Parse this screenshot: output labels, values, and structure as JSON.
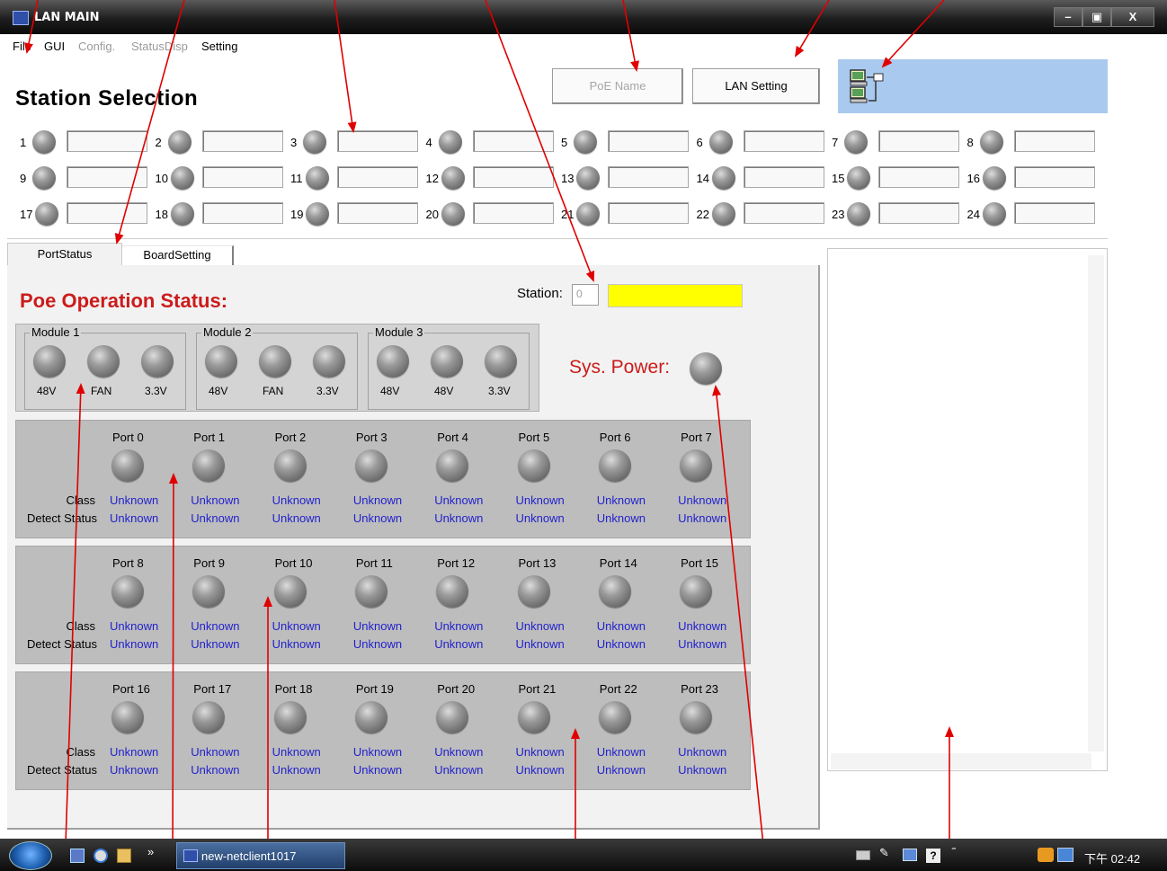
{
  "window": {
    "title": "LAN MAIN",
    "buttons": [
      "–",
      "▣",
      "X"
    ]
  },
  "menu": {
    "items": [
      {
        "label": "File",
        "enabled": true
      },
      {
        "label": "GUI",
        "enabled": true
      },
      {
        "label": "Config.",
        "enabled": false
      },
      {
        "label": "StatusDisp",
        "enabled": false
      },
      {
        "label": "Setting",
        "enabled": true
      }
    ]
  },
  "header": {
    "title": "Station Selection",
    "poe_name_button": "PoE Name",
    "lan_setting_button": "LAN Setting",
    "network_icon": "network-computers-icon"
  },
  "stations": [
    "1",
    "2",
    "3",
    "4",
    "5",
    "6",
    "7",
    "8",
    "9",
    "10",
    "11",
    "12",
    "13",
    "14",
    "15",
    "16",
    "17",
    "18",
    "19",
    "20",
    "21",
    "22",
    "23",
    "24"
  ],
  "tabs": {
    "port_status": "PortStatus",
    "board_setting": "BoardSetting"
  },
  "poe": {
    "title": "Poe Operation Status:",
    "station_label": "Station:",
    "station_value": "0",
    "station_status_color": "#ffff00",
    "sys_power_label": "Sys. Power:"
  },
  "modules": [
    {
      "title": "Module 1",
      "labels": [
        "48V",
        "FAN",
        "3.3V"
      ]
    },
    {
      "title": "Module 2",
      "labels": [
        "48V",
        "FAN",
        "3.3V"
      ]
    },
    {
      "title": "Module 3",
      "labels": [
        "48V",
        "48V",
        "3.3V"
      ]
    }
  ],
  "port_rows": {
    "class_label": "Class",
    "detect_label": "Detect Status"
  },
  "port_groups": [
    {
      "ports": [
        {
          "name": "Port 0",
          "class": "Unknown",
          "detect": "Unknown"
        },
        {
          "name": "Port 1",
          "class": "Unknown",
          "detect": "Unknown"
        },
        {
          "name": "Port 2",
          "class": "Unknown",
          "detect": "Unknown"
        },
        {
          "name": "Port 3",
          "class": "Unknown",
          "detect": "Unknown"
        },
        {
          "name": "Port 4",
          "class": "Unknown",
          "detect": "Unknown"
        },
        {
          "name": "Port 5",
          "class": "Unknown",
          "detect": "Unknown"
        },
        {
          "name": "Port 6",
          "class": "Unknown",
          "detect": "Unknown"
        },
        {
          "name": "Port 7",
          "class": "Unknown",
          "detect": "Unknown"
        }
      ]
    },
    {
      "ports": [
        {
          "name": "Port 8",
          "class": "Unknown",
          "detect": "Unknown"
        },
        {
          "name": "Port 9",
          "class": "Unknown",
          "detect": "Unknown"
        },
        {
          "name": "Port 10",
          "class": "Unknown",
          "detect": "Unknown"
        },
        {
          "name": "Port 11",
          "class": "Unknown",
          "detect": "Unknown"
        },
        {
          "name": "Port 12",
          "class": "Unknown",
          "detect": "Unknown"
        },
        {
          "name": "Port 13",
          "class": "Unknown",
          "detect": "Unknown"
        },
        {
          "name": "Port 14",
          "class": "Unknown",
          "detect": "Unknown"
        },
        {
          "name": "Port 15",
          "class": "Unknown",
          "detect": "Unknown"
        }
      ]
    },
    {
      "ports": [
        {
          "name": "Port 16",
          "class": "Unknown",
          "detect": "Unknown"
        },
        {
          "name": "Port 17",
          "class": "Unknown",
          "detect": "Unknown"
        },
        {
          "name": "Port 18",
          "class": "Unknown",
          "detect": "Unknown"
        },
        {
          "name": "Port 19",
          "class": "Unknown",
          "detect": "Unknown"
        },
        {
          "name": "Port 20",
          "class": "Unknown",
          "detect": "Unknown"
        },
        {
          "name": "Port 21",
          "class": "Unknown",
          "detect": "Unknown"
        },
        {
          "name": "Port 22",
          "class": "Unknown",
          "detect": "Unknown"
        },
        {
          "name": "Port 23",
          "class": "Unknown",
          "detect": "Unknown"
        }
      ]
    }
  ],
  "colors": {
    "accent_red": "#cc1b1b",
    "value_blue": "#2222cc",
    "annotation_red": "#e00000",
    "net_panel": "#a9c9ef"
  },
  "taskbar": {
    "task_label": "new-netclient1017",
    "clock": "下午 02:42",
    "quick_launch_icons": [
      "desktop-icon",
      "media-player-icon",
      "folder-icon"
    ],
    "overflow": "»"
  }
}
